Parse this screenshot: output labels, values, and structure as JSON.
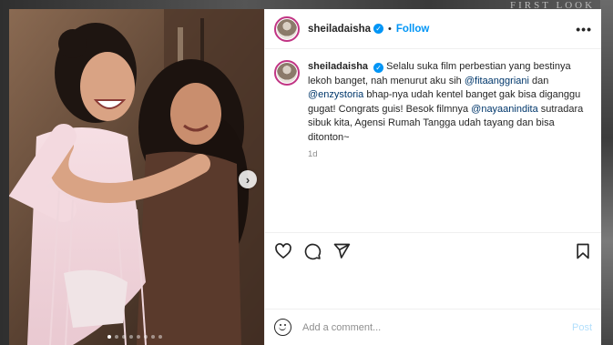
{
  "backdrop": {
    "text": "FIRST LOOK"
  },
  "post": {
    "username": "sheiladaisha",
    "follow_label": "Follow",
    "separator": "•",
    "more_icon": "more-horizontal-icon",
    "caption": {
      "text_1": "Selalu suka film perbestian yang bestinya lekoh banget, nah menurut aku sih ",
      "mention_1": "@fitaanggriani",
      "text_2": " dan ",
      "mention_2": "@enzystoria",
      "text_3": " bhap-nya udah kentel banget gak bisa diganggu gugat! Congrats guis! Besok filmnya ",
      "mention_3": "@nayaanindita",
      "text_4": " sutradara sibuk kita, Agensi Rumah Tangga udah tayang dan bisa ditonton~"
    },
    "time": "1d",
    "media": {
      "slide_count": 8,
      "active_slide": 0,
      "next_icon": "chevron-right-icon"
    }
  },
  "actions": {
    "like_icon": "heart-icon",
    "comment_icon": "comment-icon",
    "share_icon": "send-icon",
    "save_icon": "bookmark-icon"
  },
  "comment_box": {
    "placeholder": "Add a comment...",
    "post_label": "Post",
    "emoji_icon": "emoji-icon"
  },
  "colors": {
    "accent": "#0095f6",
    "mention": "#00376b",
    "post_disabled": "#b2dffc"
  }
}
